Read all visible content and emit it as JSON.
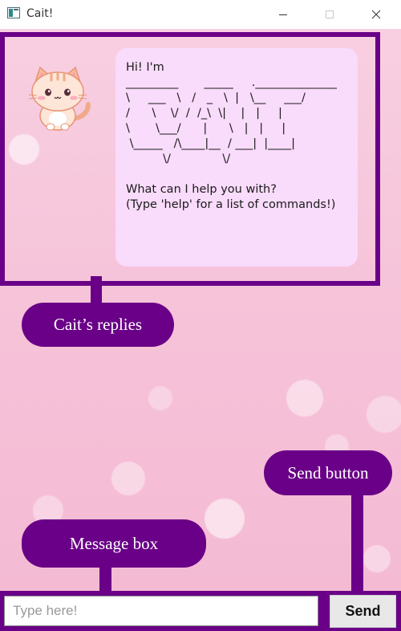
{
  "window": {
    "title": "Cait!",
    "controls": [
      "minimize-icon",
      "maximize-icon",
      "close-icon"
    ]
  },
  "dialog": {
    "avatar": "cat-avatar",
    "message": "Hi! I'm\n_________       _____     .______________\n\\     ___   \\   /   _   \\  |   \\__     ___/\n/      \\    \\/  /  /_\\  \\|    |   |     |\n\\       \\___/      |      \\   |   |     |\n \\_____   /\\____|__  / ___|  |____|\n          \\/              \\/\n\nWhat can I help you with?\n(Type 'help' for a list of commands!)"
  },
  "annotations": {
    "replies_label": "Cait’s replies",
    "send_label": "Send button",
    "message_box_label": "Message box"
  },
  "input": {
    "placeholder": "Type here!",
    "value": ""
  },
  "send_button": {
    "label": "Send"
  },
  "colors": {
    "accent": "#6a0087",
    "bubble": "#f9dbfb",
    "background": "#f6c3d9"
  }
}
